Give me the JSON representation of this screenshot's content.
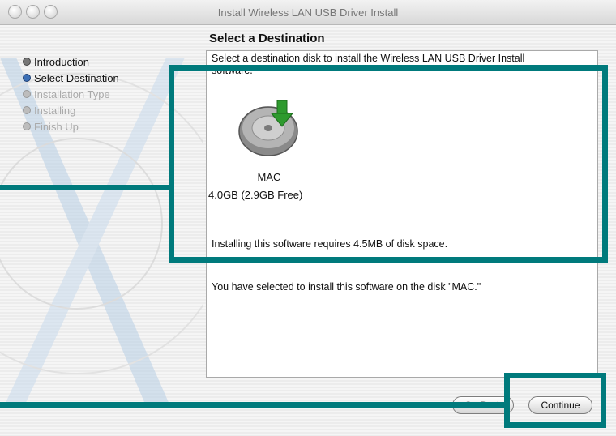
{
  "window": {
    "title": "Install Wireless LAN USB Driver Install"
  },
  "sidebar": {
    "steps": [
      {
        "label": "Introduction",
        "state": "done"
      },
      {
        "label": "Select Destination",
        "state": "current"
      },
      {
        "label": "Installation Type",
        "state": "pending"
      },
      {
        "label": "Installing",
        "state": "pending"
      },
      {
        "label": "Finish Up",
        "state": "pending"
      }
    ]
  },
  "main": {
    "heading": "Select a Destination",
    "description": "Select a destination disk to install the Wireless LAN USB Driver Install software.",
    "disk": {
      "name": "MAC",
      "size": "4.0GB (2.9GB Free)",
      "icon": "hard-disk-icon"
    },
    "requires_text": "Installing this software requires 4.5MB of disk space.",
    "selected_text": "You have selected to install this software on the disk \"MAC.\""
  },
  "buttons": {
    "go_back": "Go Back",
    "continue": "Continue"
  },
  "colors": {
    "highlight": "#007a7c",
    "disk_arrow": "#2e9a2e"
  }
}
